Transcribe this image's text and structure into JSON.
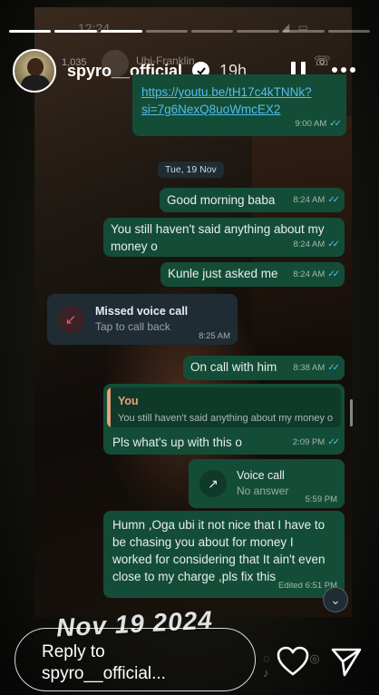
{
  "background_phone": {
    "time": "12:24",
    "viewer_count": "1,035",
    "contact_name": "Ubi-Franklin"
  },
  "header": {
    "username": "spyro__official",
    "post_time": "19h"
  },
  "chat": {
    "link_message": {
      "text_line1": "https://youtu.be/tH17c4kTNNk?",
      "text_line2": "si=7g6NexQ8uoWmcEX2",
      "time": "9:00 AM"
    },
    "date_chip": "Tue, 19 Nov",
    "messages": [
      {
        "text": "Good morning baba",
        "time": "8:24 AM"
      },
      {
        "text_line1": "You still haven't said anything about my",
        "text_line2": "money o",
        "time": "8:24 AM"
      },
      {
        "text": "Kunle just asked me",
        "time": "8:24 AM"
      },
      {
        "text": "On call with him",
        "time": "8:38 AM"
      }
    ],
    "missed_call": {
      "title": "Missed voice call",
      "subtitle": "Tap to call back",
      "time": "8:25 AM"
    },
    "reply_message": {
      "quoted_author": "You",
      "quoted_text": "You still haven't said anything about my money o",
      "text": "Pls what's up with this o",
      "time": "2:09 PM"
    },
    "voice_call": {
      "title": "Voice call",
      "subtitle": "No answer",
      "time": "5:59 PM"
    },
    "last_message": {
      "line1": "Humn ,Oga ubi it not nice that I have to",
      "line2": "be chasing you about for money I",
      "line3": "worked for considering that It ain't even",
      "line4": "close to my charge ,pls fix this",
      "status": "Edited 6:51 PM"
    }
  },
  "sticker_text": "Nov 19 2024",
  "reply_bar": {
    "placeholder_line1": "Reply to",
    "placeholder_line2": "spyro__official..."
  },
  "colors": {
    "outgoing_bubble": "#144d37",
    "incoming_bubble": "#1f2c33",
    "link": "#53bdeb",
    "read_ticks": "#53bdeb",
    "quote_accent": "#e9a178",
    "missed_call": "#f15c6d"
  },
  "icons": [
    "verified-badge-icon",
    "pause-icon",
    "more-options-icon",
    "read-ticks-icon",
    "missed-call-icon",
    "voice-call-icon",
    "scroll-down-icon",
    "heart-icon",
    "send-icon"
  ]
}
